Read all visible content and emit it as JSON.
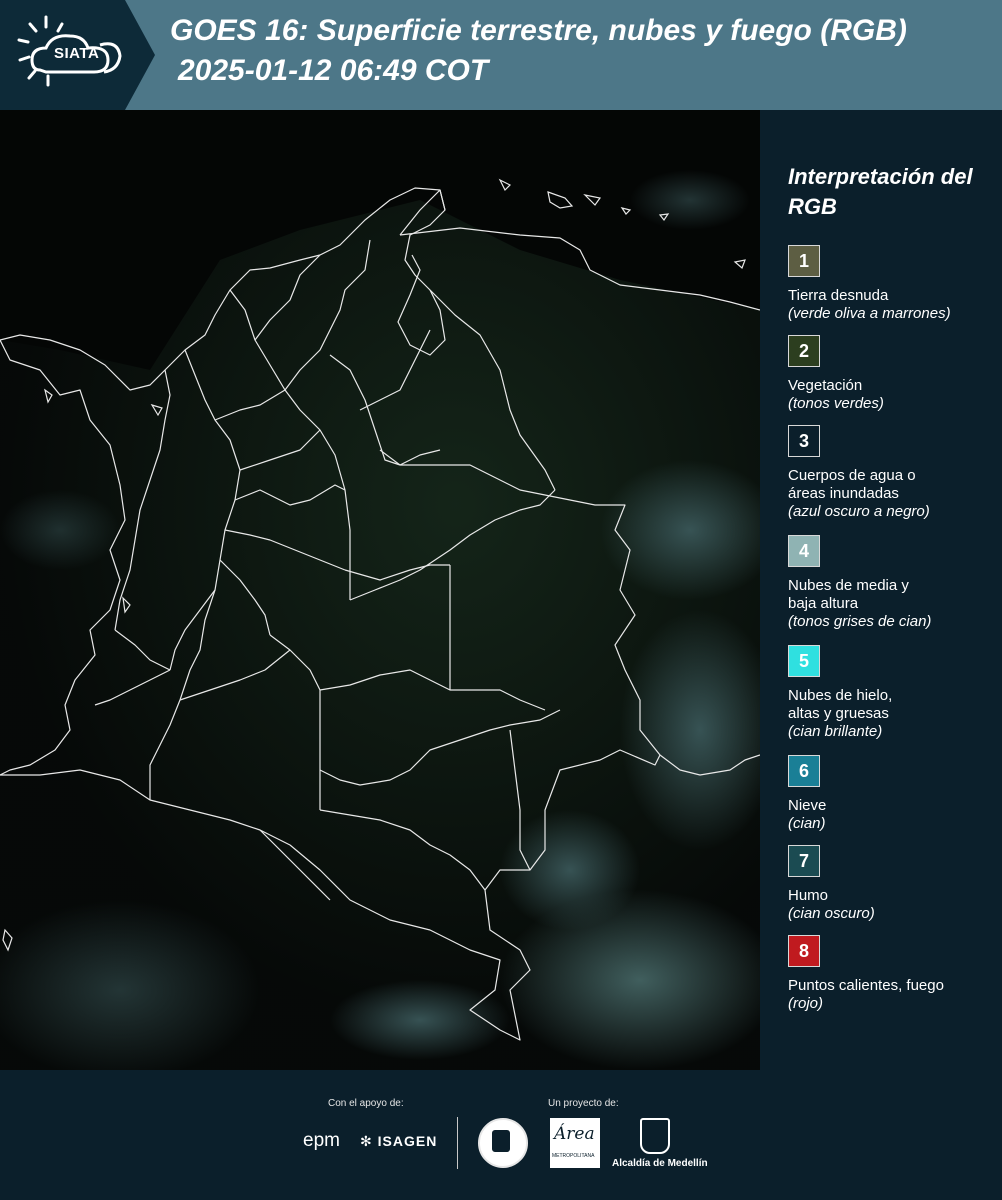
{
  "header": {
    "logo_text": "SIATA",
    "title_line1": "GOES 16: Superficie terrestre, nubes y fuego (RGB)",
    "title_line2": "2025-01-12 06:49 COT"
  },
  "legend": {
    "title": "Interpretación del RGB",
    "items": [
      {
        "number": "1",
        "color": "#5d5e43",
        "text_color": "#ffffff",
        "label": "Tierra desnuda",
        "description": "(verde oliva a marrones)"
      },
      {
        "number": "2",
        "color": "#2c3e1f",
        "text_color": "#ffffff",
        "label": "Vegetación",
        "description": "(tonos verdes)"
      },
      {
        "number": "3",
        "color": "#0b1f2b",
        "text_color": "#ffffff",
        "label": "Cuerpos de agua o áreas inundadas",
        "description": "(azul oscuro a negro)"
      },
      {
        "number": "4",
        "color": "#8fb3b3",
        "text_color": "#ffffff",
        "label": "Nubes de media y baja altura",
        "description": "(tonos grises de cian)"
      },
      {
        "number": "5",
        "color": "#2fe0e0",
        "text_color": "#ffffff",
        "label": "Nubes de hielo, altas y gruesas",
        "description": "(cian brillante)"
      },
      {
        "number": "6",
        "color": "#1a7f96",
        "text_color": "#ffffff",
        "label": "Nieve",
        "description": "(cian)"
      },
      {
        "number": "7",
        "color": "#1b4b52",
        "text_color": "#ffffff",
        "label": "Humo",
        "description": "(cian oscuro)"
      },
      {
        "number": "8",
        "color": "#c01a1f",
        "text_color": "#ffffff",
        "label": "Puntos calientes, fuego",
        "description": "(rojo)"
      }
    ]
  },
  "footer": {
    "support_caption": "Con el apoyo de:",
    "project_caption": "Un proyecto de:",
    "sponsors": [
      "epm",
      "ISAGEN"
    ],
    "partners": [
      "METROPOLITANA",
      "Alcaldía de Medellín"
    ]
  },
  "colors": {
    "header_bg": "#4d7788",
    "page_bg": "#0b1f2b",
    "map_bg": "#050807",
    "boundary": "#e8e8e8"
  }
}
